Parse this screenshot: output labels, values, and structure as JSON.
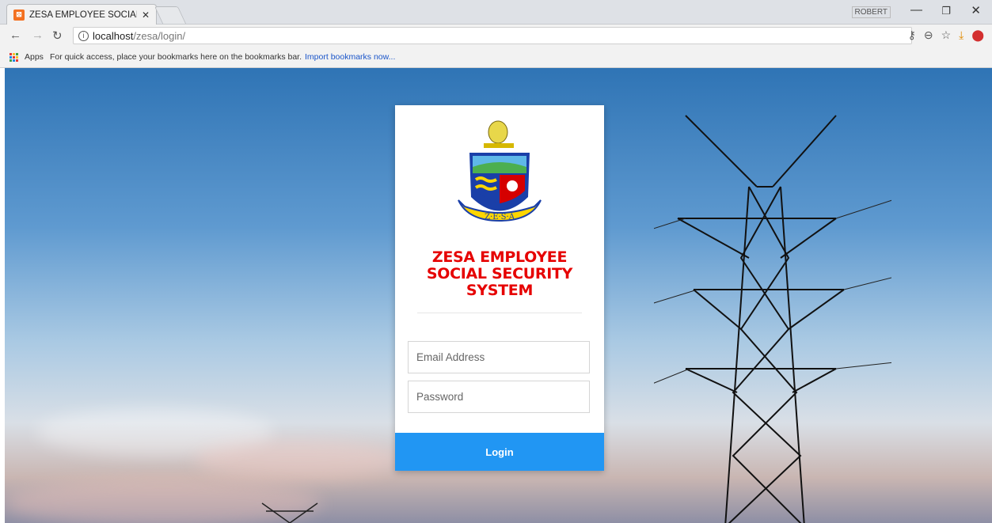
{
  "browser": {
    "tab_title": "ZESA EMPLOYEE SOCIAL",
    "tab_favicon": "xampp-favicon-icon",
    "profile_name": "ROBERT",
    "url_host": "localhost",
    "url_path": "/zesa/login/",
    "bookmarks_apps": "Apps",
    "bookmarks_hint": "For quick access, place your bookmarks here on the bookmarks bar.",
    "bookmarks_import": "Import bookmarks now..."
  },
  "login": {
    "title_line1": "ZESA EMPLOYEE",
    "title_line2": "SOCIAL SECURITY",
    "title_line3": "SYSTEM",
    "email_placeholder": "Email Address",
    "email_value": "",
    "password_placeholder": "Password",
    "password_value": "",
    "button_label": "Login",
    "crest_motto": "Z·E·S·A"
  },
  "colors": {
    "title_red": "#e60000",
    "button_blue": "#2196f3"
  }
}
